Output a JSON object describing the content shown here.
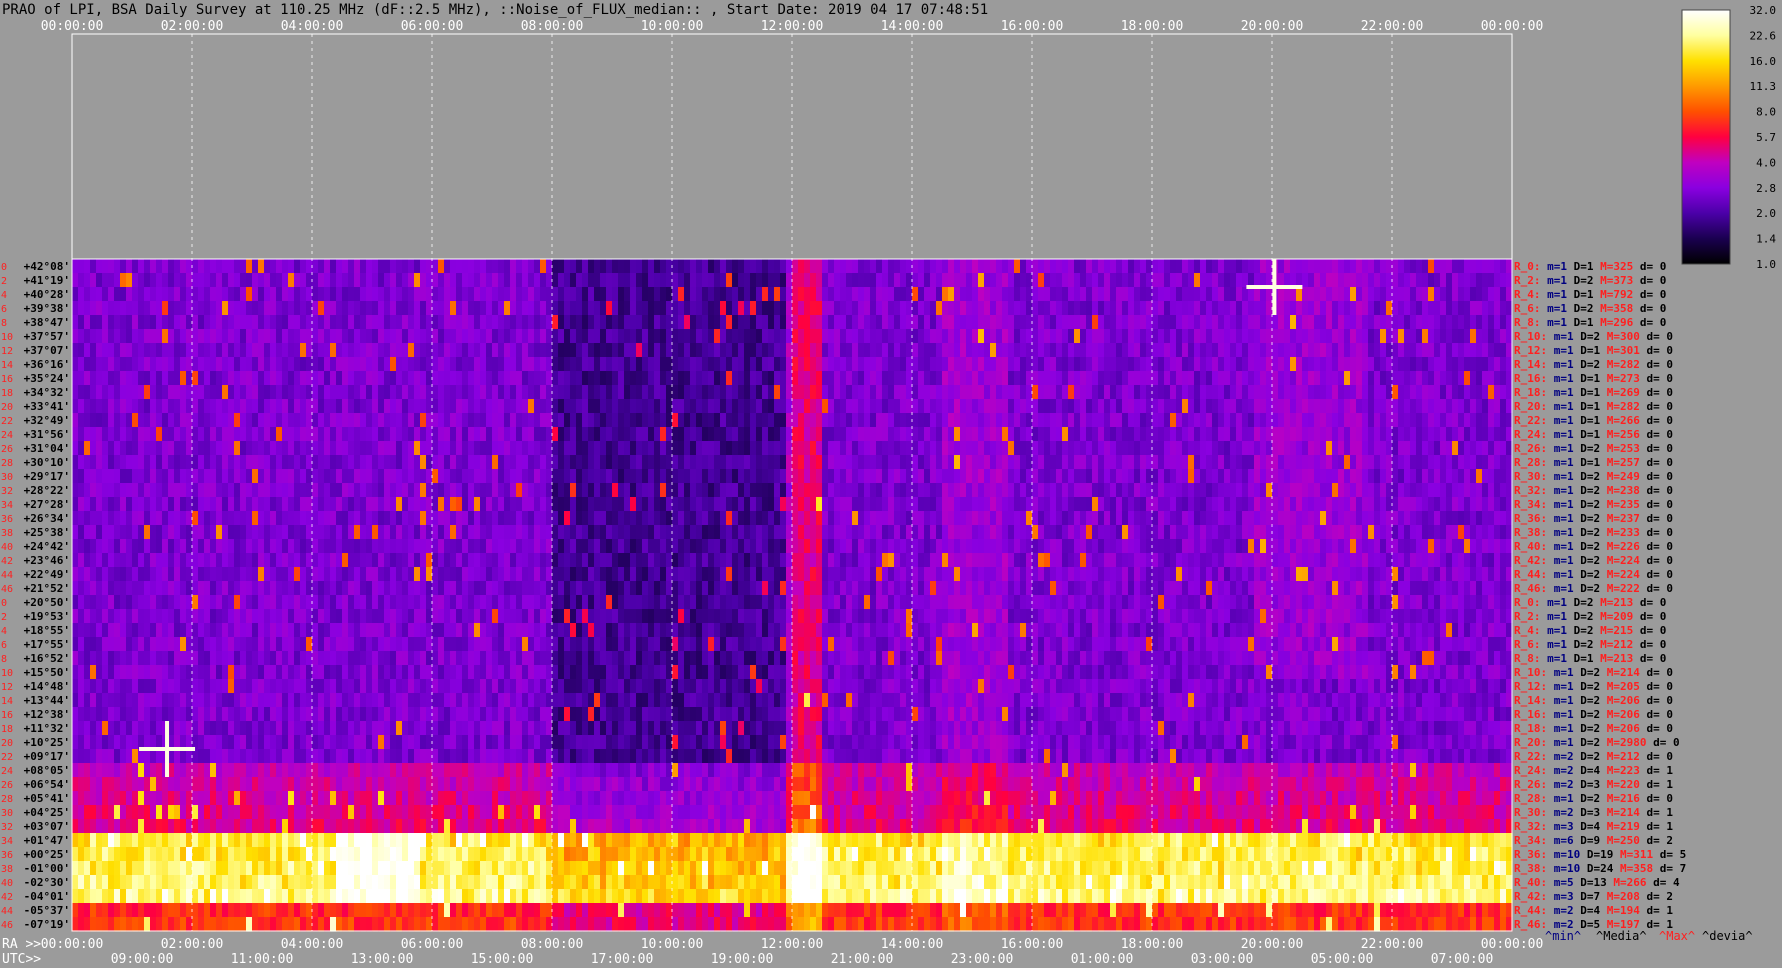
{
  "title": "PRAO of LPI, BSA Daily Survey at 110.25 MHz (dF::2.5 MHz), ::Noise_of_FLUX_median:: , Start Date: 2019 04 17 07:48:51",
  "chart_data": {
    "type": "heatmap",
    "title": "PRAO of LPI, BSA Daily Survey at 110.25 MHz (dF::2.5 MHz), ::Noise_of_FLUX_median:: , Start Date: 2019 04 17 07:48:51",
    "top_axis_ticks": [
      "00:00:00",
      "02:00:00",
      "04:00:00",
      "06:00:00",
      "08:00:00",
      "10:00:00",
      "12:00:00",
      "14:00:00",
      "16:00:00",
      "18:00:00",
      "20:00:00",
      "22:00:00",
      "00:00:00"
    ],
    "ra_axis_label": "RA >>",
    "ra_ticks": [
      "00:00:00",
      "02:00:00",
      "04:00:00",
      "06:00:00",
      "08:00:00",
      "10:00:00",
      "12:00:00",
      "14:00:00",
      "16:00:00",
      "18:00:00",
      "20:00:00",
      "22:00:00",
      "00:00:00"
    ],
    "utc_axis_label": "UTC>>",
    "utc_ticks": [
      "09:00:00",
      "11:00:00",
      "13:00:00",
      "15:00:00",
      "17:00:00",
      "19:00:00",
      "21:00:00",
      "23:00:00",
      "01:00:00",
      "03:00:00",
      "05:00:00",
      "07:00:00"
    ],
    "dec_labels": [
      "+42°08'",
      "+41°19'",
      "+40°28'",
      "+39°38'",
      "+38°47'",
      "+37°57'",
      "+37°07'",
      "+36°16'",
      "+35°24'",
      "+34°32'",
      "+33°41'",
      "+32°49'",
      "+31°56'",
      "+31°04'",
      "+30°10'",
      "+29°17'",
      "+28°22'",
      "+27°28'",
      "+26°34'",
      "+25°38'",
      "+24°42'",
      "+23°46'",
      "+22°49'",
      "+21°52'",
      "+20°50'",
      "+19°53'",
      "+18°55'",
      "+17°55'",
      "+16°52'",
      "+15°50'",
      "+14°48'",
      "+13°44'",
      "+12°38'",
      "+11°32'",
      "+10°25'",
      "+09°17'",
      "+08°05'",
      "+06°54'",
      "+05°41'",
      "+04°25'",
      "+03°07'",
      "+01°47'",
      "+00°25'",
      "-01°00'",
      "-02°30'",
      "-04°01'",
      "-05°37'",
      "-07°19'"
    ],
    "row_numbers": [
      "0",
      "2",
      "4",
      "6",
      "8",
      "10",
      "12",
      "14",
      "16",
      "18",
      "20",
      "22",
      "24",
      "26",
      "28",
      "30",
      "32",
      "34",
      "36",
      "38",
      "40",
      "42",
      "44",
      "46",
      "0",
      "2",
      "4",
      "6",
      "8",
      "10",
      "12",
      "14",
      "16",
      "18",
      "20",
      "22",
      "24",
      "26",
      "28",
      "30",
      "32",
      "34",
      "36",
      "38",
      "40",
      "42",
      "44",
      "46"
    ],
    "row_stats": [
      {
        "r": "R_0:",
        "m": "m=1",
        "D": "D=1",
        "M": "M=325",
        "d": "d= 0"
      },
      {
        "r": "R_2:",
        "m": "m=1",
        "D": "D=2",
        "M": "M=373",
        "d": "d= 0"
      },
      {
        "r": "R_4:",
        "m": "m=1",
        "D": "D=1",
        "M": "M=792",
        "d": "d= 0"
      },
      {
        "r": "R_6:",
        "m": "m=1",
        "D": "D=2",
        "M": "M=358",
        "d": "d= 0"
      },
      {
        "r": "R_8:",
        "m": "m=1",
        "D": "D=1",
        "M": "M=296",
        "d": "d= 0"
      },
      {
        "r": "R_10:",
        "m": "m=1",
        "D": "D=2",
        "M": "M=300",
        "d": "d= 0"
      },
      {
        "r": "R_12:",
        "m": "m=1",
        "D": "D=1",
        "M": "M=301",
        "d": "d= 0"
      },
      {
        "r": "R_14:",
        "m": "m=1",
        "D": "D=2",
        "M": "M=282",
        "d": "d= 0"
      },
      {
        "r": "R_16:",
        "m": "m=1",
        "D": "D=1",
        "M": "M=273",
        "d": "d= 0"
      },
      {
        "r": "R_18:",
        "m": "m=1",
        "D": "D=1",
        "M": "M=269",
        "d": "d= 0"
      },
      {
        "r": "R_20:",
        "m": "m=1",
        "D": "D=1",
        "M": "M=282",
        "d": "d= 0"
      },
      {
        "r": "R_22:",
        "m": "m=1",
        "D": "D=1",
        "M": "M=266",
        "d": "d= 0"
      },
      {
        "r": "R_24:",
        "m": "m=1",
        "D": "D=1",
        "M": "M=256",
        "d": "d= 0"
      },
      {
        "r": "R_26:",
        "m": "m=1",
        "D": "D=2",
        "M": "M=253",
        "d": "d= 0"
      },
      {
        "r": "R_28:",
        "m": "m=1",
        "D": "D=1",
        "M": "M=257",
        "d": "d= 0"
      },
      {
        "r": "R_30:",
        "m": "m=1",
        "D": "D=2",
        "M": "M=249",
        "d": "d= 0"
      },
      {
        "r": "R_32:",
        "m": "m=1",
        "D": "D=2",
        "M": "M=238",
        "d": "d= 0"
      },
      {
        "r": "R_34:",
        "m": "m=1",
        "D": "D=2",
        "M": "M=235",
        "d": "d= 0"
      },
      {
        "r": "R_36:",
        "m": "m=1",
        "D": "D=2",
        "M": "M=237",
        "d": "d= 0"
      },
      {
        "r": "R_38:",
        "m": "m=1",
        "D": "D=2",
        "M": "M=233",
        "d": "d= 0"
      },
      {
        "r": "R_40:",
        "m": "m=1",
        "D": "D=2",
        "M": "M=226",
        "d": "d= 0"
      },
      {
        "r": "R_42:",
        "m": "m=1",
        "D": "D=2",
        "M": "M=224",
        "d": "d= 0"
      },
      {
        "r": "R_44:",
        "m": "m=1",
        "D": "D=2",
        "M": "M=224",
        "d": "d= 0"
      },
      {
        "r": "R_46:",
        "m": "m=1",
        "D": "D=2",
        "M": "M=222",
        "d": "d= 0"
      },
      {
        "r": "R_0:",
        "m": "m=1",
        "D": "D=2",
        "M": "M=213",
        "d": "d= 0"
      },
      {
        "r": "R_2:",
        "m": "m=1",
        "D": "D=2",
        "M": "M=209",
        "d": "d= 0"
      },
      {
        "r": "R_4:",
        "m": "m=1",
        "D": "D=2",
        "M": "M=215",
        "d": "d= 0"
      },
      {
        "r": "R_6:",
        "m": "m=1",
        "D": "D=2",
        "M": "M=212",
        "d": "d= 0"
      },
      {
        "r": "R_8:",
        "m": "m=1",
        "D": "D=1",
        "M": "M=213",
        "d": "d= 0"
      },
      {
        "r": "R_10:",
        "m": "m=1",
        "D": "D=2",
        "M": "M=214",
        "d": "d= 0"
      },
      {
        "r": "R_12:",
        "m": "m=1",
        "D": "D=2",
        "M": "M=205",
        "d": "d= 0"
      },
      {
        "r": "R_14:",
        "m": "m=1",
        "D": "D=2",
        "M": "M=206",
        "d": "d= 0"
      },
      {
        "r": "R_16:",
        "m": "m=1",
        "D": "D=2",
        "M": "M=206",
        "d": "d= 0"
      },
      {
        "r": "R_18:",
        "m": "m=1",
        "D": "D=2",
        "M": "M=206",
        "d": "d= 0"
      },
      {
        "r": "R_20:",
        "m": "m=1",
        "D": "D=2",
        "M": "M=2980",
        "d": "d= 0"
      },
      {
        "r": "R_22:",
        "m": "m=2",
        "D": "D=2",
        "M": "M=212",
        "d": "d= 0"
      },
      {
        "r": "R_24:",
        "m": "m=2",
        "D": "D=4",
        "M": "M=223",
        "d": "d= 1"
      },
      {
        "r": "R_26:",
        "m": "m=2",
        "D": "D=3",
        "M": "M=220",
        "d": "d= 1"
      },
      {
        "r": "R_28:",
        "m": "m=1",
        "D": "D=2",
        "M": "M=216",
        "d": "d= 0"
      },
      {
        "r": "R_30:",
        "m": "m=2",
        "D": "D=3",
        "M": "M=214",
        "d": "d= 1"
      },
      {
        "r": "R_32:",
        "m": "m=3",
        "D": "D=4",
        "M": "M=219",
        "d": "d= 1"
      },
      {
        "r": "R_34:",
        "m": "m=6",
        "D": "D=9",
        "M": "M=250",
        "d": "d= 2"
      },
      {
        "r": "R_36:",
        "m": "m=10",
        "D": "D=19",
        "M": "M=311",
        "d": "d= 5"
      },
      {
        "r": "R_38:",
        "m": "m=10",
        "D": "D=24",
        "M": "M=358",
        "d": "d= 7"
      },
      {
        "r": "R_40:",
        "m": "m=5",
        "D": "D=13",
        "M": "M=266",
        "d": "d= 4"
      },
      {
        "r": "R_42:",
        "m": "m=3",
        "D": "D=7",
        "M": "M=208",
        "d": "d= 2"
      },
      {
        "r": "R_44:",
        "m": "m=2",
        "D": "D=4",
        "M": "M=194",
        "d": "d= 1"
      },
      {
        "r": "R_46:",
        "m": "m=2",
        "D": "D=5",
        "M": "M=197",
        "d": "d= 1"
      }
    ],
    "stats_legend": {
      "min": "^min^",
      "media": "^Media^",
      "max": "^Max^",
      "devia": "^devia^"
    },
    "colorbar": {
      "ticks": [
        "32.0",
        "22.6",
        "16.0",
        "11.3",
        "8.0",
        "5.7",
        "4.0",
        "2.8",
        "2.0",
        "1.4",
        "1.0"
      ],
      "tick_values": [
        32.0,
        22.6,
        16.0,
        11.3,
        8.0,
        5.7,
        4.0,
        2.8,
        2.0,
        1.4,
        1.0
      ],
      "scale": "log",
      "colormap": [
        "#000000",
        "#1a0050",
        "#4b00a8",
        "#8a00e0",
        "#c000c0",
        "#ff0040",
        "#ff5000",
        "#ff9a00",
        "#ffe000",
        "#ffffa0",
        "#ffffff"
      ]
    },
    "grid": true,
    "colors": {
      "background": "#9b9b9b",
      "row_stat_label": "#ff2020",
      "row_stat_text": "#000000",
      "min_label": "#000080",
      "media_label": "#000000",
      "max_label": "#ff2020",
      "devia_label": "#000000",
      "dec_label": "#000000",
      "row_number": "#ff2020",
      "tick_text": "#ffffff"
    }
  }
}
